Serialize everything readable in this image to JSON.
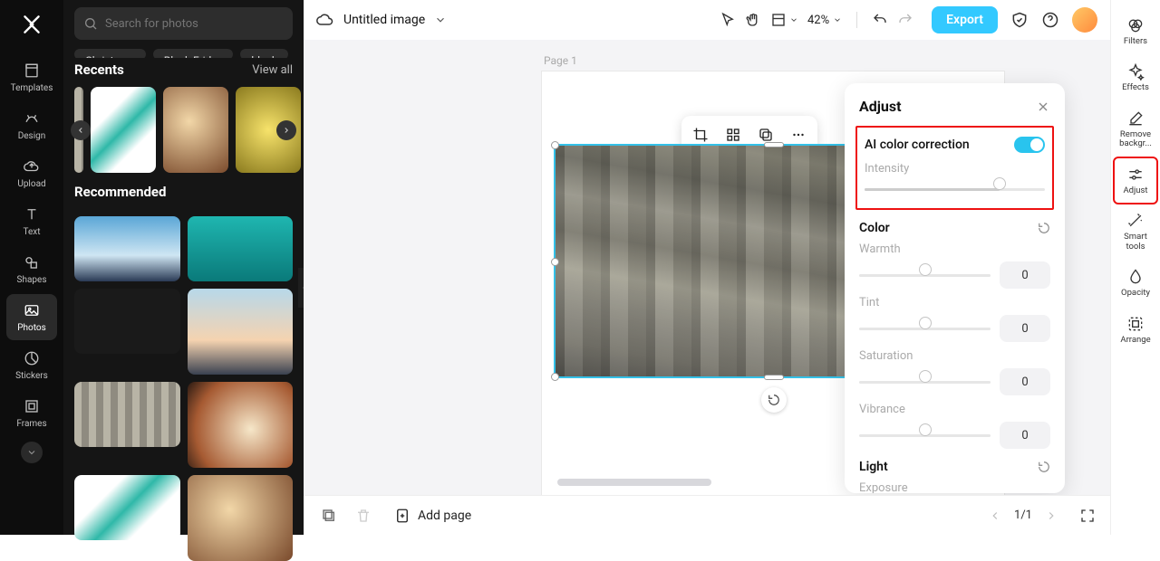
{
  "leftNav": {
    "items": [
      {
        "label": "Templates"
      },
      {
        "label": "Design"
      },
      {
        "label": "Upload"
      },
      {
        "label": "Text"
      },
      {
        "label": "Shapes"
      },
      {
        "label": "Photos"
      },
      {
        "label": "Stickers"
      },
      {
        "label": "Frames"
      }
    ]
  },
  "sidePanel": {
    "searchPlaceholder": "Search for photos",
    "tags": [
      "Christmas",
      "Black Friday",
      "black"
    ],
    "recents": {
      "title": "Recents",
      "viewAll": "View all"
    },
    "recommended": {
      "title": "Recommended"
    }
  },
  "topbar": {
    "title": "Untitled image",
    "zoom": "42%",
    "export": "Export"
  },
  "canvas": {
    "pageLabel": "Page 1"
  },
  "bottombar": {
    "addPage": "Add page",
    "page": "1/1"
  },
  "rightRail": {
    "items": [
      {
        "label": "Filters"
      },
      {
        "label": "Effects"
      },
      {
        "label": "Remove backgr..."
      },
      {
        "label": "Adjust"
      },
      {
        "label": "Smart tools"
      },
      {
        "label": "Opacity"
      },
      {
        "label": "Arrange"
      }
    ]
  },
  "adjust": {
    "title": "Adjust",
    "ai": {
      "label": "AI color correction",
      "intensityLabel": "Intensity",
      "intensityPct": 75
    },
    "color": {
      "title": "Color",
      "warmth": {
        "label": "Warmth",
        "value": "0"
      },
      "tint": {
        "label": "Tint",
        "value": "0"
      },
      "saturation": {
        "label": "Saturation",
        "value": "0"
      },
      "vibrance": {
        "label": "Vibrance",
        "value": "0"
      }
    },
    "light": {
      "title": "Light",
      "exposure": {
        "label": "Exposure"
      }
    }
  }
}
